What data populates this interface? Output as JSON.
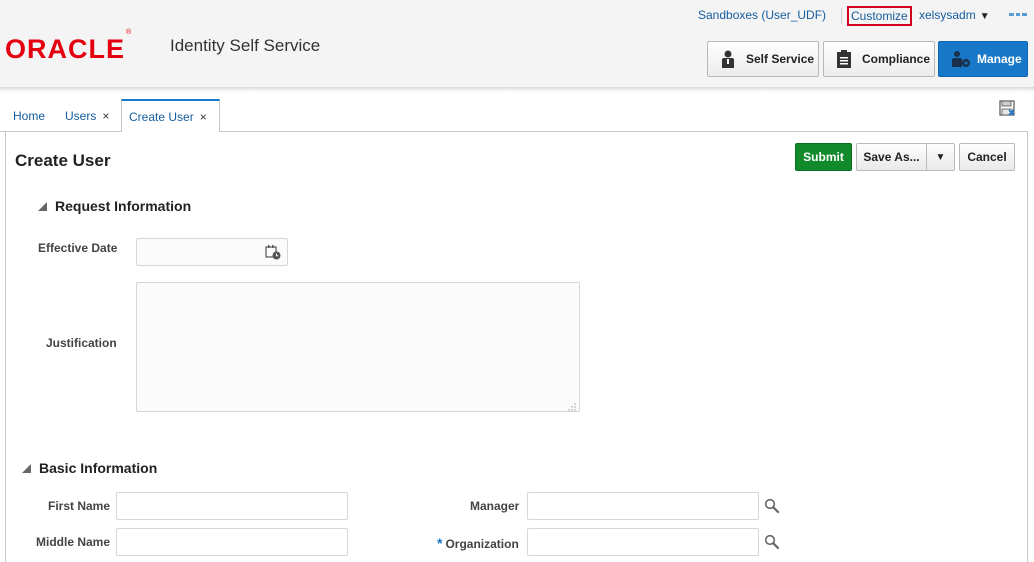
{
  "header": {
    "logo_text": "ORACLE",
    "logo_reg": "®",
    "app_title": "Identity Self Service",
    "global_links": {
      "sandboxes": "Sandboxes (User_UDF)",
      "customize": "Customize",
      "user": "xelsysadm"
    },
    "nav_buttons": {
      "self_service": "Self Service",
      "compliance": "Compliance",
      "manage": "Manage"
    },
    "colors": {
      "oracle_red": "#e4000f",
      "manage_blue": "#1777c9",
      "customize_outline": "#d1001c"
    }
  },
  "tabs": {
    "home": "Home",
    "users": "Users",
    "create_user": "Create User",
    "close_glyph": "×"
  },
  "page": {
    "title": "Create User",
    "actions": {
      "submit": "Submit",
      "save_as": "Save As...",
      "cancel": "Cancel"
    },
    "request_information": {
      "title": "Request Information",
      "effective_date_label": "Effective Date",
      "effective_date_value": "",
      "justification_label": "Justification",
      "justification_value": ""
    },
    "basic_information": {
      "title": "Basic Information",
      "first_name_label": "First Name",
      "middle_name_label": "Middle Name",
      "manager_label": "Manager",
      "organization_label": "Organization",
      "required_marker": "*"
    },
    "colors": {
      "submit_green": "#118a2c"
    }
  }
}
